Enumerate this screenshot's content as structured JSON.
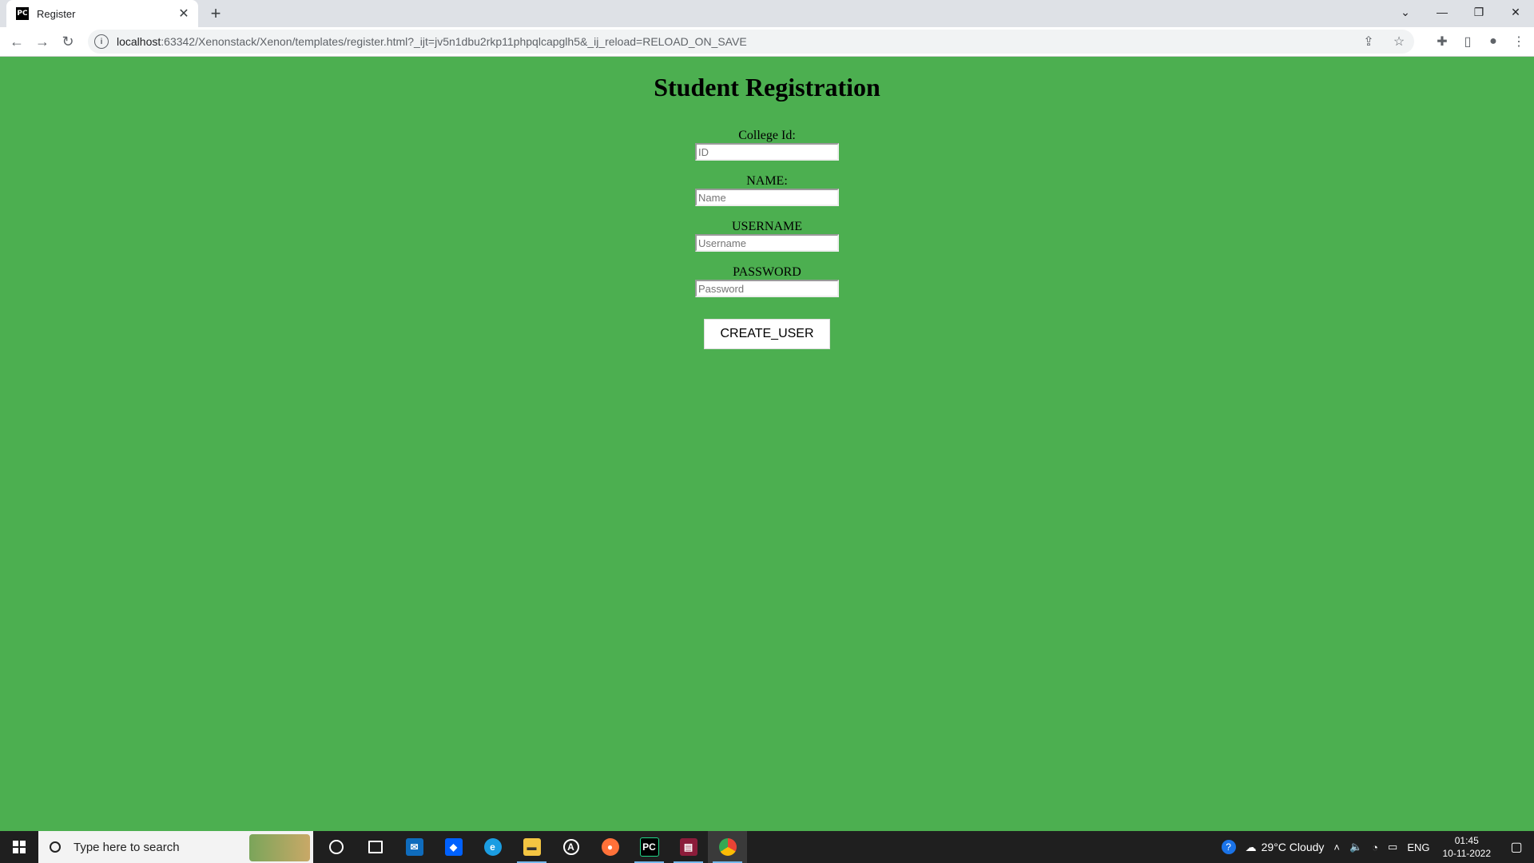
{
  "browser": {
    "tab_title": "Register",
    "tab_favicon_text": "PC",
    "url_host": "localhost",
    "url_rest": ":63342/Xenonstack/Xenon/templates/register.html?_ijt=jv5n1dbu2rkp11phpqlcapglh5&_ij_reload=RELOAD_ON_SAVE"
  },
  "page": {
    "title": "Student Registration",
    "background_color": "#4caf50",
    "fields": [
      {
        "label": "College Id:",
        "placeholder": "ID",
        "value": ""
      },
      {
        "label": "NAME:",
        "placeholder": "Name",
        "value": ""
      },
      {
        "label": "USERNAME",
        "placeholder": "Username",
        "value": ""
      },
      {
        "label": "PASSWORD",
        "placeholder": "Password",
        "value": ""
      }
    ],
    "submit_label": "CREATE_USER"
  },
  "taskbar": {
    "search_placeholder": "Type here to search",
    "weather": "29°C  Cloudy",
    "language": "ENG",
    "time": "01:45",
    "date": "10-11-2022"
  }
}
